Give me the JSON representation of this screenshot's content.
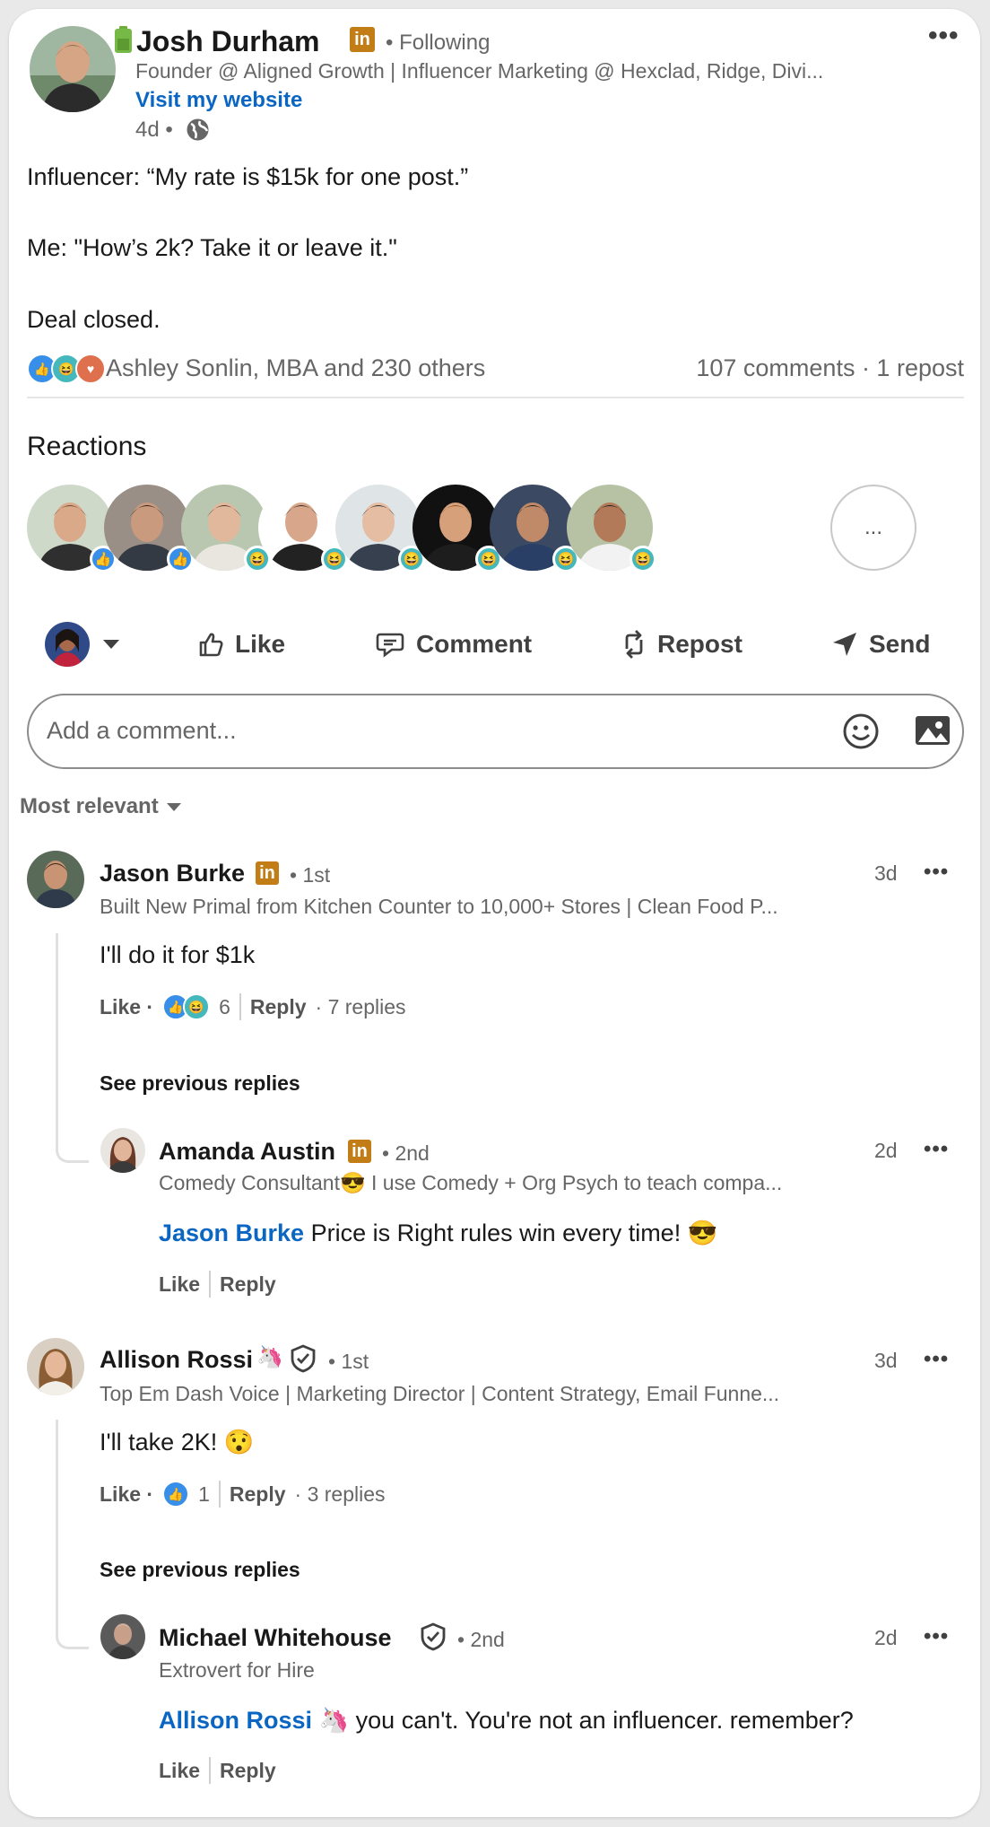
{
  "post": {
    "author": "Josh Durham",
    "following": "• Following",
    "headline": "Founder @ Aligned Growth | Influencer Marketing @ Hexclad, Ridge, Divi...",
    "website": "Visit my website",
    "time": "4d •",
    "lines": [
      "Influencer: “My rate is $15k for one post.”",
      "Me: \"How’s 2k? Take it or leave it.\"",
      "Deal closed."
    ],
    "reactors": "Ashley Sonlin, MBA and 230 others",
    "stats": "107 comments · 1 repost"
  },
  "reactions": {
    "title": "Reactions",
    "more": "...",
    "people": [
      {
        "mini": "like",
        "skin": "#d9a98a",
        "shirt": "#2f2f2f",
        "hair": "#6b4a2f",
        "bg": "#cfd9c9"
      },
      {
        "mini": "like",
        "skin": "#c99a7d",
        "shirt": "#333a44",
        "hair": "#2c2016",
        "bg": "#9a8f86"
      },
      {
        "mini": "funny",
        "skin": "#e2b89c",
        "shirt": "#e9e6df",
        "hair": "#4e3322",
        "bg": "#b9c7b1"
      },
      {
        "mini": "funny",
        "skin": "#d8a78b",
        "shirt": "#222222",
        "hair": "#3c2a1e",
        "bg": "#ffffff"
      },
      {
        "mini": "funny",
        "skin": "#e4bda3",
        "shirt": "#37404f",
        "hair": "#2a2a2a",
        "bg": "#dfe4e6"
      },
      {
        "mini": "funny",
        "skin": "#d6a07b",
        "shirt": "#1d1d1d",
        "hair": "#8b5a2b",
        "bg": "#111111"
      },
      {
        "mini": "funny",
        "skin": "#c08a68",
        "shirt": "#2a3f66",
        "hair": "#1e1b18",
        "bg": "#3b4a62"
      },
      {
        "mini": "funny",
        "skin": "#b27a58",
        "shirt": "#f2f2f2",
        "hair": "#1e1e1e",
        "bg": "#b7c2a5"
      }
    ]
  },
  "actions": {
    "like": "Like",
    "comment": "Comment",
    "repost": "Repost",
    "send": "Send"
  },
  "composer": {
    "placeholder": "Add a comment..."
  },
  "sort": {
    "label": "Most relevant"
  },
  "comments": [
    {
      "name": "Jason Burke",
      "degree": "• 1st",
      "headline": "Built New Primal from Kitchen Counter to 10,000+ Stores | Clean Food P...",
      "time": "3d",
      "text": "I'll do it for $1k",
      "like": "Like ·",
      "count": "6",
      "reply": "Reply",
      "replies": "· 7 replies",
      "see_previous": "See previous replies",
      "reply_item": {
        "name": "Amanda Austin",
        "degree": "• 2nd",
        "headline": "Comedy Consultant😎 I use Comedy + Org Psych to teach compa...",
        "time": "2d",
        "mention": "Jason Burke",
        "text": " Price is Right rules win every time! 😎",
        "like": "Like",
        "reply": "Reply"
      }
    },
    {
      "name": "Allison Rossi",
      "badge": "🦄",
      "degree": "• 1st",
      "headline": "Top Em Dash Voice | Marketing Director | Content Strategy, Email Funne...",
      "time": "3d",
      "text": "I'll take 2K! 😯",
      "like": "Like ·",
      "count": "1",
      "reply": "Reply",
      "replies": "· 3 replies",
      "see_previous": "See previous replies",
      "reply_item": {
        "name": "Michael Whitehouse",
        "degree": "• 2nd",
        "headline": "Extrovert for Hire",
        "time": "2d",
        "mention": "Allison Rossi 🦄",
        "text": " you can't. You're not an influencer. remember?",
        "like": "Like",
        "reply": "Reply"
      }
    }
  ],
  "colors": {
    "accent": "#0a66c2",
    "premium": "#c37d16",
    "like": "#378fe9",
    "funny": "#44b8bc",
    "love": "#df704d"
  }
}
